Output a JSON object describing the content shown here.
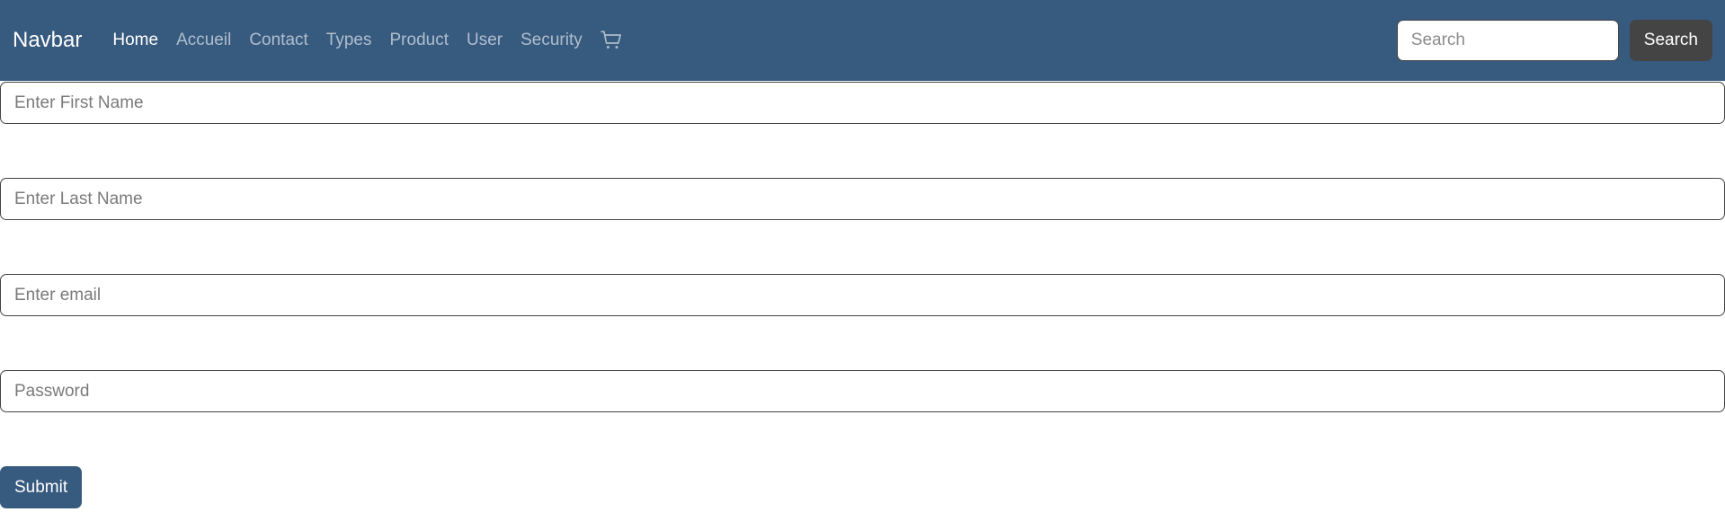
{
  "navbar": {
    "brand": "Navbar",
    "links": [
      {
        "label": "Home",
        "active": true
      },
      {
        "label": "Accueil",
        "active": false
      },
      {
        "label": "Contact",
        "active": false
      },
      {
        "label": "Types",
        "active": false
      },
      {
        "label": "Product",
        "active": false
      },
      {
        "label": "User",
        "active": false
      },
      {
        "label": "Security",
        "active": false
      }
    ],
    "cart_icon": "shopping-cart-icon",
    "search": {
      "placeholder": "Search",
      "value": "",
      "button_label": "Search"
    }
  },
  "form": {
    "first_name": {
      "placeholder": "Enter First Name",
      "value": ""
    },
    "last_name": {
      "placeholder": "Enter Last Name",
      "value": ""
    },
    "email": {
      "placeholder": "Enter email",
      "value": ""
    },
    "password": {
      "placeholder": "Password",
      "value": ""
    },
    "submit_label": "Submit"
  },
  "colors": {
    "navbar_bg": "#375a7f",
    "search_button_bg": "#444444",
    "submit_button_bg": "#375a7f"
  }
}
